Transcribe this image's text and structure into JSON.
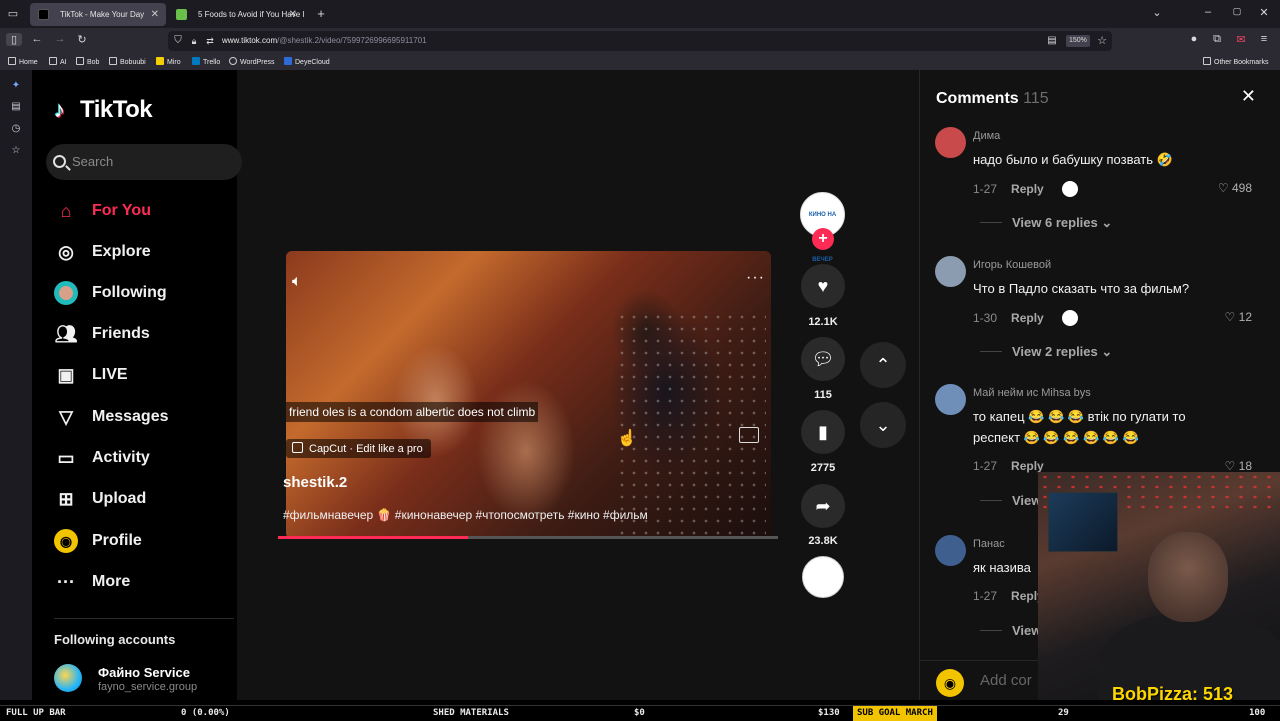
{
  "browser": {
    "tabs": [
      {
        "label": "TikTok - Make Your Day",
        "active": true
      },
      {
        "label": "5 Foods to Avoid if You Have I",
        "active": false
      }
    ],
    "url_host": "www.tiktok.com",
    "url_path": "/@shestik.2/video/7599726996695911701",
    "zoom": "150%",
    "bookmarks": [
      "Home",
      "AI",
      "Bob",
      "Bobuubi",
      "Miro",
      "Trello",
      "WordPress",
      "DeyeCloud"
    ],
    "other_bookmarks": "Other Bookmarks"
  },
  "sidebar": {
    "logo": "TikTok",
    "search_placeholder": "Search",
    "items": [
      {
        "label": "For You",
        "icon": "home-icon"
      },
      {
        "label": "Explore",
        "icon": "compass-icon"
      },
      {
        "label": "Following",
        "icon": "following-avatar-icon"
      },
      {
        "label": "Friends",
        "icon": "friends-icon"
      },
      {
        "label": "LIVE",
        "icon": "live-icon"
      },
      {
        "label": "Messages",
        "icon": "messages-icon"
      },
      {
        "label": "Activity",
        "icon": "activity-icon"
      },
      {
        "label": "Upload",
        "icon": "upload-icon"
      },
      {
        "label": "Profile",
        "icon": "profile-icon"
      },
      {
        "label": "More",
        "icon": "more-icon"
      }
    ],
    "following_title": "Following accounts",
    "following": [
      {
        "name": "Файно Service",
        "handle": "fayno_service.group"
      }
    ]
  },
  "video": {
    "caption": "friend oles is a condom albertic does not climb",
    "capcut": "CapCut · Edit like a pro",
    "author": "shestik.2",
    "tags": "#фильмнавечер 🍿 #кинонавечер #чтопосмотреть #кино #фильм",
    "progress": 0.38,
    "actions": {
      "likes": "12.1K",
      "comments": "115",
      "saves": "2775",
      "shares": "23.8K"
    },
    "avatar_text": "КИНО НА ВЕЧЕР"
  },
  "comments": {
    "title": "Comments",
    "count": "115",
    "add_placeholder": "Add cor",
    "items": [
      {
        "name": "Дима",
        "text": "надо было и бабушку позвать 🤣",
        "date": "1-27",
        "reply": "Reply",
        "likes": "498",
        "replies": "View 6 replies",
        "avatar_color": "#c94a4a"
      },
      {
        "name": "Игорь Кошевой",
        "text": "Что в Падло сказать что за фильм?",
        "date": "1-30",
        "reply": "Reply",
        "likes": "12",
        "replies": "View 2 replies",
        "avatar_color": "#8b9bb0"
      },
      {
        "name": "Май нейм ис Mihsa bys",
        "text": "то капец 😂 😂 😂 втік по гулати то респект 😂 😂 😂 😂 😂 😂",
        "date": "1-27",
        "reply": "Reply",
        "likes": "18",
        "replies": "View",
        "avatar_color": "#6f8fb8"
      },
      {
        "name": "Панас",
        "text": "як назива",
        "date": "1-27",
        "reply": "Reply",
        "likes": "",
        "replies": "View",
        "avatar_color": "#3f5f8f"
      }
    ]
  },
  "stream": {
    "bobpizza": "BobPizza: 513",
    "ticker": [
      {
        "text": "FULL UP BAR"
      },
      {
        "text": "0 (0.00%)"
      },
      {
        "text": "SHED MATERIALS"
      },
      {
        "text": "$0"
      },
      {
        "text": "$130"
      },
      {
        "text": "SUB GOAL MARCH",
        "highlight": true
      },
      {
        "text": "29"
      },
      {
        "text": "100"
      }
    ]
  }
}
